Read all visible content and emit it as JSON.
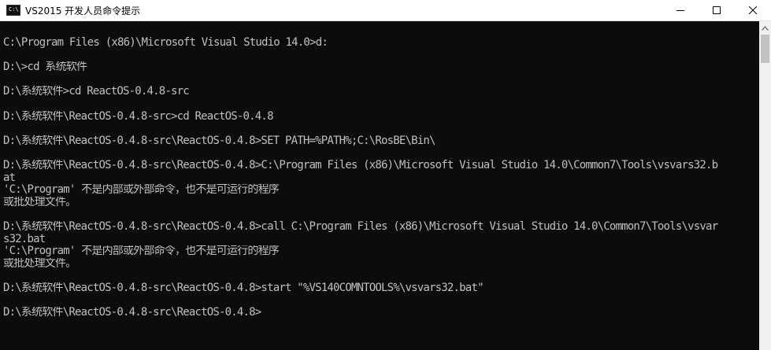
{
  "window": {
    "title": "VS2015 开发人员命令提示",
    "icon": "cmd-icon",
    "controls": {
      "minimize": "minimize-icon",
      "maximize": "maximize-icon",
      "close": "close-icon"
    }
  },
  "console": {
    "lines": [
      "C:\\Program Files (x86)\\Microsoft Visual Studio 14.0>d:",
      "",
      "D:\\>cd 系统软件",
      "",
      "D:\\系统软件>cd ReactOS-0.4.8-src",
      "",
      "D:\\系统软件\\ReactOS-0.4.8-src>cd ReactOS-0.4.8",
      "",
      "D:\\系统软件\\ReactOS-0.4.8-src\\ReactOS-0.4.8>SET PATH=%PATH%;C:\\RosBE\\Bin\\",
      "",
      "D:\\系统软件\\ReactOS-0.4.8-src\\ReactOS-0.4.8>C:\\Program Files (x86)\\Microsoft Visual Studio 14.0\\Common7\\Tools\\vsvars32.b",
      "at",
      "'C:\\Program' 不是内部或外部命令，也不是可运行的程序",
      "或批处理文件。",
      "",
      "D:\\系统软件\\ReactOS-0.4.8-src\\ReactOS-0.4.8>call C:\\Program Files (x86)\\Microsoft Visual Studio 14.0\\Common7\\Tools\\vsvar",
      "s32.bat",
      "'C:\\Program' 不是内部或外部命令，也不是可运行的程序",
      "或批处理文件。",
      "",
      "D:\\系统软件\\ReactOS-0.4.8-src\\ReactOS-0.4.8>start \"%VS140COMNTOOLS%\\vsvars32.bat\"",
      "",
      "D:\\系统软件\\ReactOS-0.4.8-src\\ReactOS-0.4.8>"
    ]
  },
  "colors": {
    "console_bg": "#0c0c0c",
    "console_text": "#c0c0c0",
    "titlebar_bg": "#ffffff"
  }
}
